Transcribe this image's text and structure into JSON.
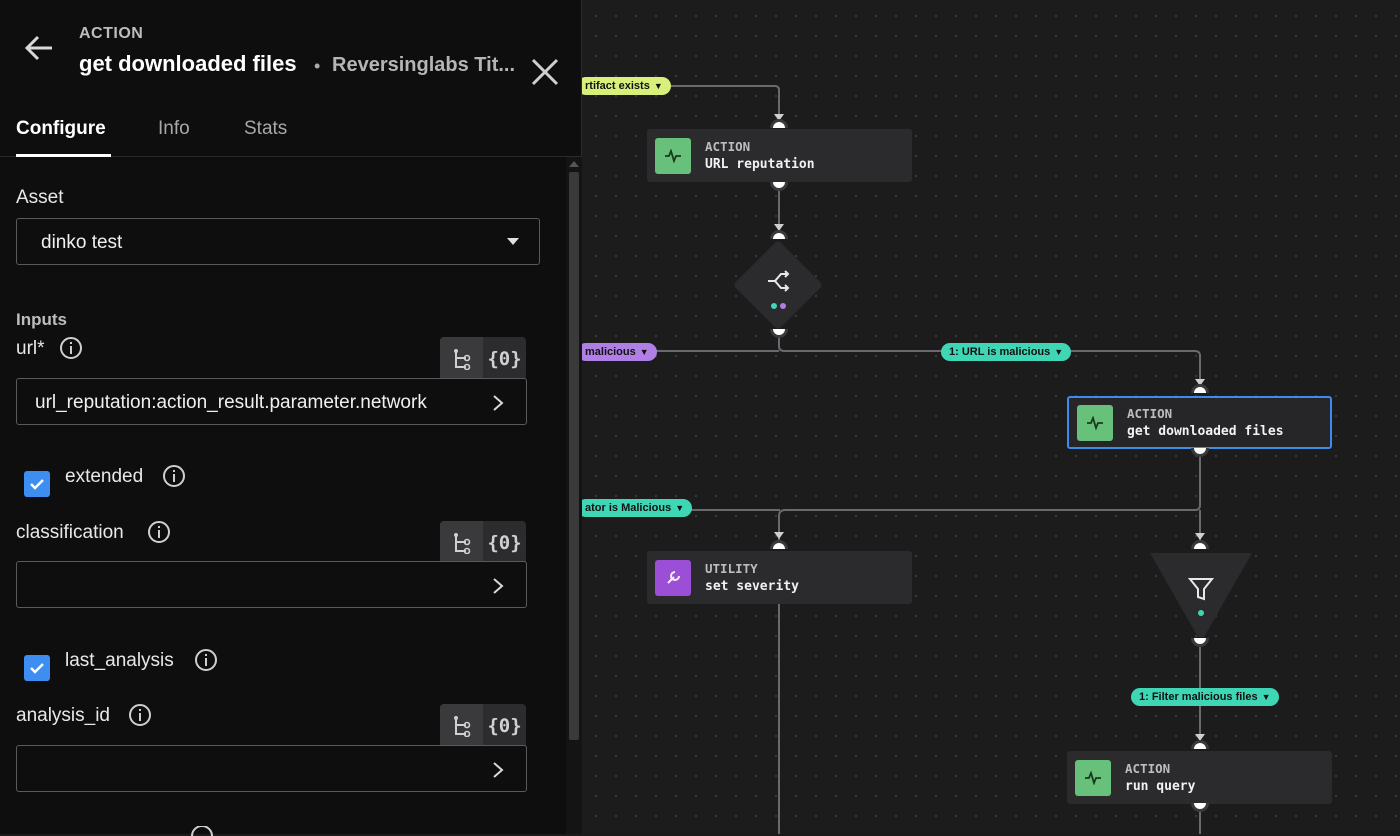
{
  "panel": {
    "kicker": "ACTION",
    "title": "get downloaded files",
    "subtitle": "Reversinglabs Tit...",
    "separator": "•",
    "tabs": [
      {
        "label": "Configure",
        "active": true
      },
      {
        "label": "Info",
        "active": false
      },
      {
        "label": "Stats",
        "active": false
      }
    ],
    "asset": {
      "label": "Asset",
      "value": "dinko test"
    },
    "inputs_label": "Inputs",
    "fields": {
      "url": {
        "label": "url*",
        "value": "url_reputation:action_result.parameter.network"
      },
      "extended": {
        "label": "extended",
        "checked": true
      },
      "classification": {
        "label": "classification",
        "value": ""
      },
      "last_analysis": {
        "label": "last_analysis",
        "checked": true
      },
      "analysis_id": {
        "label": "analysis_id",
        "value": ""
      }
    },
    "tool_token": "{0}"
  },
  "canvas": {
    "nodes": [
      {
        "type": "ACTION",
        "name": "URL reputation",
        "icon": "activity-icon",
        "color": "#68c17a"
      },
      {
        "type": "ACTION",
        "name": "get downloaded files",
        "icon": "activity-icon",
        "color": "#68c17a",
        "selected": true
      },
      {
        "type": "UTILITY",
        "name": "set severity",
        "icon": "wrench-icon",
        "color": "#9a4fd6"
      },
      {
        "type": "ACTION",
        "name": "run query",
        "icon": "activity-icon",
        "color": "#68c17a"
      }
    ],
    "edge_labels": {
      "artifact": "rtifact exists",
      "malicious_left": "malicious",
      "url_malicious": "1: URL is malicious",
      "indicator": "ator is Malicious",
      "filter": "1: Filter malicious files"
    },
    "colors": {
      "accent_blue": "#3a8ee8",
      "yellow": "#d8f07a",
      "purple": "#b07fe6",
      "teal": "#3fd6b5"
    }
  }
}
